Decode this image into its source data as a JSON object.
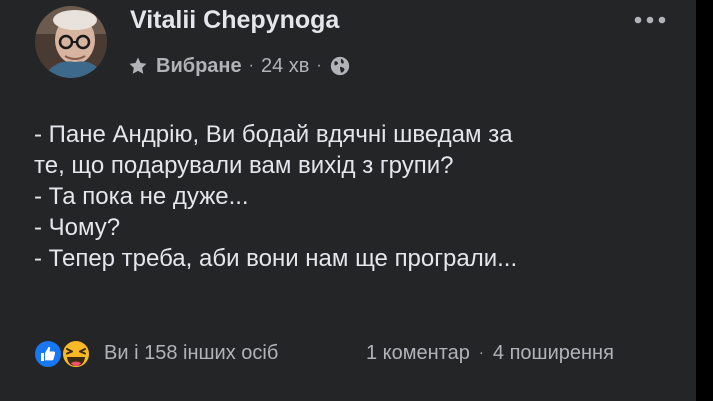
{
  "post": {
    "author": "Vitalii Chepynoga",
    "audience_label": "Вибране",
    "time": "24 хв",
    "separator": "·",
    "lines": [
      "- Пане Андрію, Ви бодай вдячні шведам за",
      "те, що подарували вам вихід з групи?",
      "- Та пока не дуже...",
      "- Чому?",
      "- Тепер треба, аби вони нам ще програли..."
    ]
  },
  "footer": {
    "reactions_text": "Ви і 158 інших осіб",
    "comments": "1 коментар",
    "shares": "4 поширення"
  },
  "icons": {
    "audience": "star-icon",
    "privacy": "globe-icon",
    "menu": "more-options-icon",
    "reactions": [
      "like-reaction-icon",
      "haha-reaction-icon"
    ]
  },
  "colors": {
    "card_bg": "#242526",
    "text_primary": "#e4e6eb",
    "text_secondary": "#b0b3b8",
    "like_blue": "#1877f2",
    "haha_yellow": "#f7b928"
  }
}
